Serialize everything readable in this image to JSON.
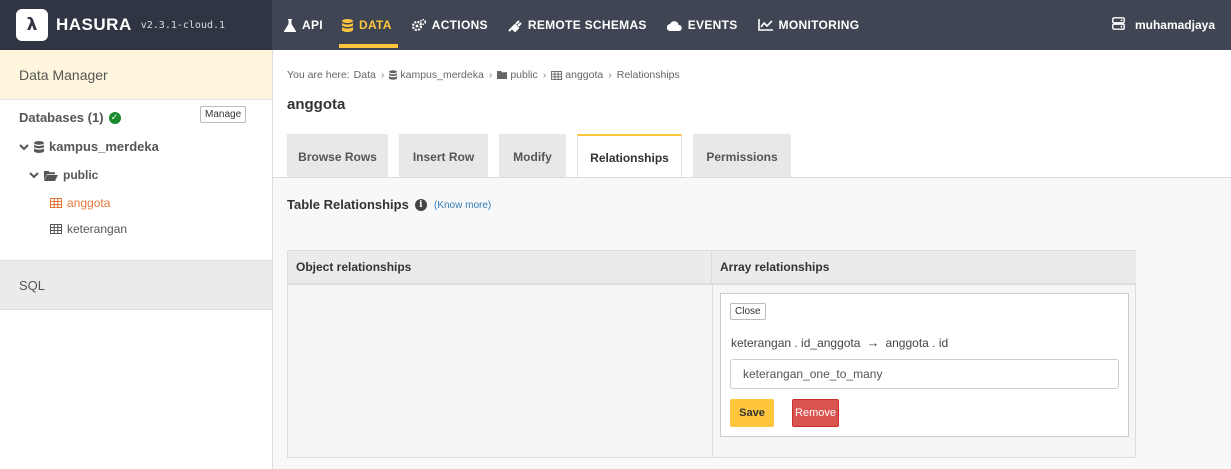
{
  "brand": {
    "name": "HASURA",
    "version": "v2.3.1-cloud.1"
  },
  "nav": [
    {
      "label": "API",
      "icon": "flask-icon"
    },
    {
      "label": "DATA",
      "icon": "database-icon",
      "active": true
    },
    {
      "label": "ACTIONS",
      "icon": "gears-icon"
    },
    {
      "label": "REMOTE SCHEMAS",
      "icon": "plug-icon"
    },
    {
      "label": "EVENTS",
      "icon": "cloud-icon"
    },
    {
      "label": "MONITORING",
      "icon": "line-chart-icon"
    }
  ],
  "user": {
    "name": "muhamadjaya"
  },
  "sidebar": {
    "header": "Data Manager",
    "databases_label": "Databases (1)",
    "manage_label": "Manage",
    "database": "kampus_merdeka",
    "schema": "public",
    "tables": [
      {
        "name": "anggota",
        "active": true
      },
      {
        "name": "keterangan",
        "active": false
      }
    ],
    "sql_label": "SQL"
  },
  "breadcrumb": {
    "prefix": "You are here:",
    "items": [
      "Data",
      "kampus_merdeka",
      "public",
      "anggota",
      "Relationships"
    ]
  },
  "page_title": "anggota",
  "tabs": [
    {
      "label": "Browse Rows"
    },
    {
      "label": "Insert Row"
    },
    {
      "label": "Modify"
    },
    {
      "label": "Relationships",
      "active": true
    },
    {
      "label": "Permissions"
    }
  ],
  "relationships": {
    "title": "Table Relationships",
    "know_more": "(Know more)",
    "object_header": "Object relationships",
    "array_header": "Array relationships",
    "card": {
      "close_label": "Close",
      "from": "keterangan . id_anggota",
      "arrow": "→",
      "to": "anggota . id",
      "name_value": "keterangan_one_to_many",
      "save_label": "Save",
      "remove_label": "Remove"
    }
  },
  "colors": {
    "accent": "#fec53d",
    "topbar": "#3f4553",
    "danger": "#d9534f",
    "active_table": "#e8763b",
    "success": "#1a8a2e"
  }
}
